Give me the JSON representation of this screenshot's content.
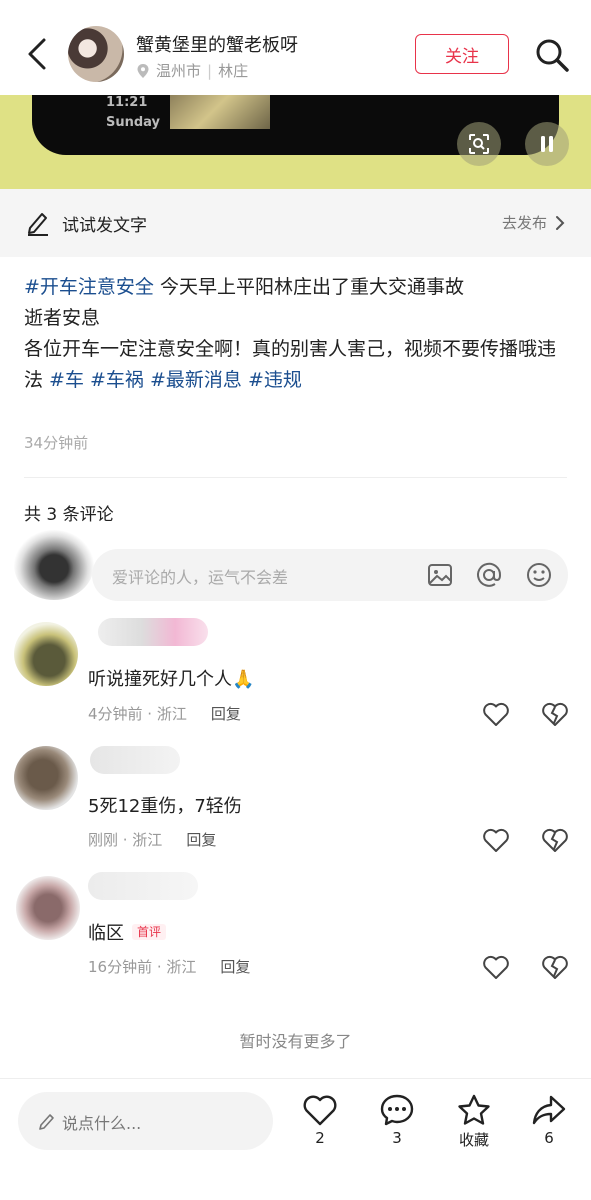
{
  "header": {
    "author": "蟹黄堡里的蟹老板呀",
    "location_city": "温州市",
    "location_separator": "|",
    "location_area": "林庄",
    "follow_label": "关注"
  },
  "video": {
    "phone_time": "11:21",
    "phone_day": "Sunday"
  },
  "try_bar": {
    "label": "试试发文字",
    "link": "去发布"
  },
  "post": {
    "tag1": "#开车注意安全",
    "line1": " 今天早上平阳林庄出了重大交通事故",
    "line2": "逝者安息",
    "line3": "各位开车一定注意安全啊！真的别害人害己，视频不要传播哦违法 ",
    "tag2": "#车",
    "tag3": "#车祸",
    "tag4": "#最新消息",
    "tag5": "#违规",
    "time": "34分钟前"
  },
  "comments_header": "共 3 条评论",
  "comment_input": {
    "placeholder": "爱评论的人，运气不会差"
  },
  "comments": [
    {
      "text": "听说撞死好几个人🙏",
      "meta": "4分钟前 · 浙江",
      "reply": "回复"
    },
    {
      "text": "5死12重伤，7轻伤",
      "meta": "刚刚 · 浙江",
      "reply": "回复"
    },
    {
      "text": "临区",
      "badge": "首评",
      "meta": "16分钟前 · 浙江",
      "reply": "回复"
    }
  ],
  "no_more": "暂时没有更多了",
  "bottom_bar": {
    "say_placeholder": "说点什么...",
    "likes": "2",
    "comments": "3",
    "collect_label": "收藏",
    "shares": "6"
  },
  "colors": {
    "accent_red": "#e8334a",
    "hashtag_blue": "#1b4e8f",
    "video_bg": "#dfe185"
  }
}
